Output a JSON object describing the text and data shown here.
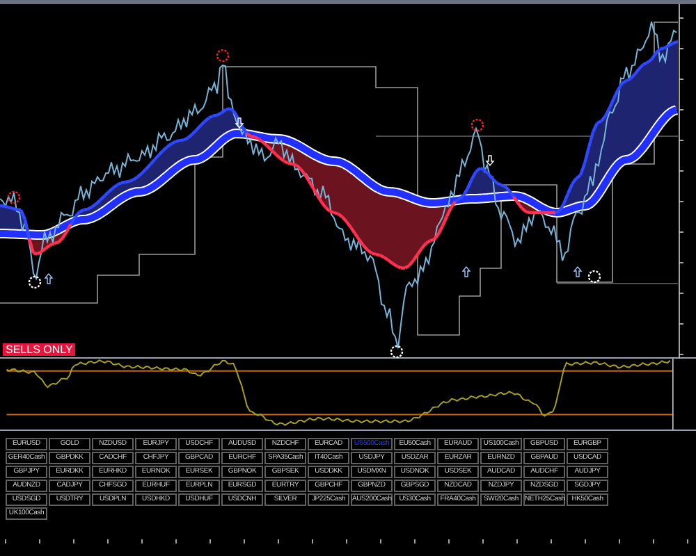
{
  "chart": {
    "signal_label": "SELLS ONLY"
  },
  "symbol_buttons": [
    {
      "label": "EURUSD",
      "selected": false
    },
    {
      "label": "GOLD",
      "selected": false
    },
    {
      "label": "NZDUSD",
      "selected": false
    },
    {
      "label": "EURJPY",
      "selected": false
    },
    {
      "label": "USDCHF",
      "selected": false
    },
    {
      "label": "AUDUSD",
      "selected": false
    },
    {
      "label": "NZDCHF",
      "selected": false
    },
    {
      "label": "EURCAD",
      "selected": false
    },
    {
      "label": "US500Cash",
      "selected": true
    },
    {
      "label": "EU50Cash",
      "selected": false
    },
    {
      "label": "EURAUD",
      "selected": false
    },
    {
      "label": "US100Cash",
      "selected": false
    },
    {
      "label": "GBPUSD",
      "selected": false
    },
    {
      "label": "EURGBP",
      "selected": false
    },
    {
      "label": "GER40Cash",
      "selected": false
    },
    {
      "label": "GBPDKK",
      "selected": false
    },
    {
      "label": "CADCHF",
      "selected": false
    },
    {
      "label": "CHFJPY",
      "selected": false
    },
    {
      "label": "GBPCAD",
      "selected": false
    },
    {
      "label": "EURCHF",
      "selected": false
    },
    {
      "label": "SPA35Cash",
      "selected": false
    },
    {
      "label": "IT40Cash",
      "selected": false
    },
    {
      "label": "USDJPY",
      "selected": false
    },
    {
      "label": "USDZAR",
      "selected": false
    },
    {
      "label": "EURZAR",
      "selected": false
    },
    {
      "label": "EURNZD",
      "selected": false
    },
    {
      "label": "GBPAUD",
      "selected": false
    },
    {
      "label": "USDCAD",
      "selected": false
    },
    {
      "label": "GBPJPY",
      "selected": false
    },
    {
      "label": "EURDKK",
      "selected": false
    },
    {
      "label": "EURHKD",
      "selected": false
    },
    {
      "label": "EURNOK",
      "selected": false
    },
    {
      "label": "EURSEK",
      "selected": false
    },
    {
      "label": "GBPNOK",
      "selected": false
    },
    {
      "label": "GBPSEK",
      "selected": false
    },
    {
      "label": "USDDKK",
      "selected": false
    },
    {
      "label": "USDMXN",
      "selected": false
    },
    {
      "label": "USDNOK",
      "selected": false
    },
    {
      "label": "USDSEK",
      "selected": false
    },
    {
      "label": "AUDCAD",
      "selected": false
    },
    {
      "label": "AUDCHF",
      "selected": false
    },
    {
      "label": "AUDJPY",
      "selected": false
    },
    {
      "label": "AUDNZD",
      "selected": false
    },
    {
      "label": "CADJPY",
      "selected": false
    },
    {
      "label": "CHFSGD",
      "selected": false
    },
    {
      "label": "EURHUF",
      "selected": false
    },
    {
      "label": "EURPLN",
      "selected": false
    },
    {
      "label": "EURSGD",
      "selected": false
    },
    {
      "label": "EURTRY",
      "selected": false
    },
    {
      "label": "GBPCHF",
      "selected": false
    },
    {
      "label": "GBPNZD",
      "selected": false
    },
    {
      "label": "GBPSGD",
      "selected": false
    },
    {
      "label": "NZDCAD",
      "selected": false
    },
    {
      "label": "NZDJPY",
      "selected": false
    },
    {
      "label": "NZDSGD",
      "selected": false
    },
    {
      "label": "SGDJPY",
      "selected": false
    },
    {
      "label": "USDSGD",
      "selected": false
    },
    {
      "label": "USDTRY",
      "selected": false
    },
    {
      "label": "USDPLN",
      "selected": false
    },
    {
      "label": "USDHKD",
      "selected": false
    },
    {
      "label": "USDHUF",
      "selected": false
    },
    {
      "label": "USDCNH",
      "selected": false
    },
    {
      "label": "SILVER",
      "selected": false
    },
    {
      "label": "JP225Cash",
      "selected": false
    },
    {
      "label": "AUS200Cash",
      "selected": false
    },
    {
      "label": "US30Cash",
      "selected": false
    },
    {
      "label": "FRA40Cash",
      "selected": false
    },
    {
      "label": "SWI20Cash",
      "selected": false
    },
    {
      "label": "NETH25Cash",
      "selected": false
    },
    {
      "label": "HK50Cash",
      "selected": false
    },
    {
      "label": "UK100Cash",
      "selected": false
    }
  ]
}
